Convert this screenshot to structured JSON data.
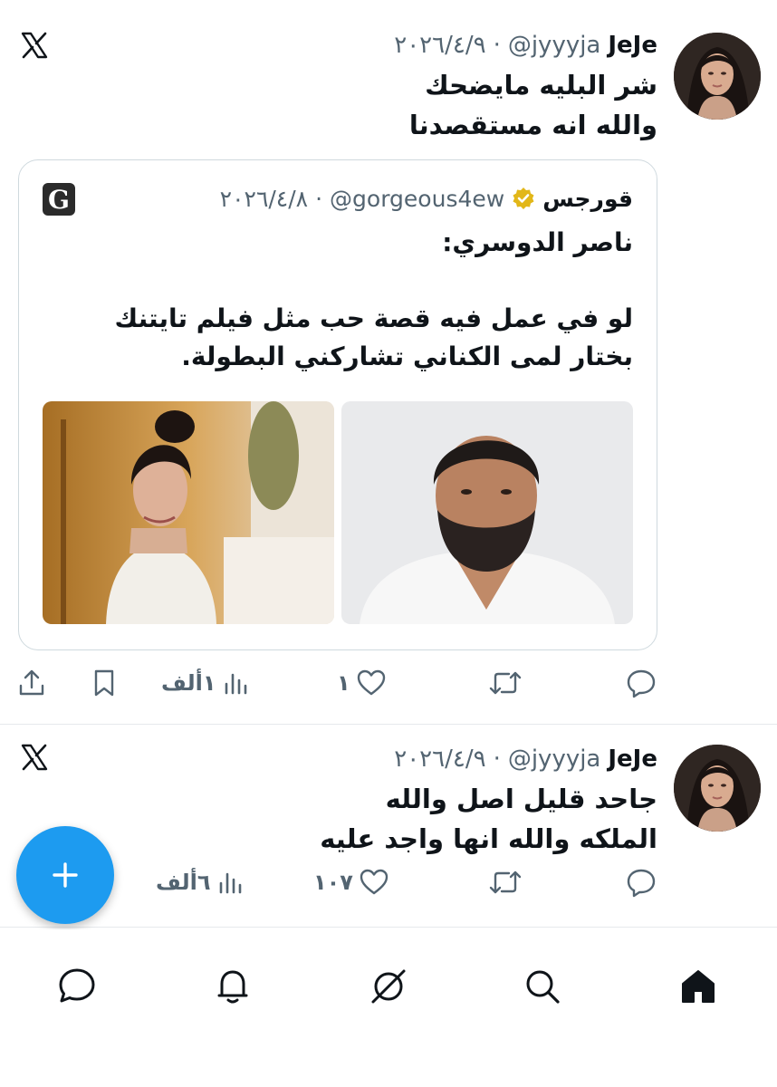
{
  "tweets": [
    {
      "display_name": "JeJe",
      "handle": "@jyyyja",
      "separator": "·",
      "date": "٢٠٢٦/٤/٩",
      "text_lines": [
        "شر البليه مايضحك",
        "والله انه مستقصدنا"
      ],
      "quote": {
        "display_name": "قورجس",
        "handle": "@gorgeous4ew",
        "separator": "·",
        "date": "٢٠٢٦/٤/٨",
        "badge": "G",
        "text_lines": [
          "ناصر الدوسري:",
          "",
          "لو في عمل فيه قصة حب مثل فيلم تايتنك",
          "بختار لمى الكناني تشاركني البطولة."
        ]
      },
      "actions": {
        "reply_count": "",
        "retweet_count": "",
        "like_count": "١",
        "views_count": "١ألف"
      }
    },
    {
      "display_name": "JeJe",
      "handle": "@jyyyja",
      "separator": "·",
      "date": "٢٠٢٦/٤/٩",
      "text_lines": [
        "جاحد قليل اصل والله",
        "الملكه والله انها واجد عليه"
      ],
      "actions": {
        "reply_count": "",
        "retweet_count": "",
        "like_count": "١٠٧",
        "views_count": "٦ألف"
      }
    }
  ],
  "fab": {
    "label": "+"
  },
  "colors": {
    "accent": "#1d9bf0",
    "muted": "#536471",
    "text": "#0f1419",
    "verified": "#e2b719"
  },
  "nav": [
    "home-icon",
    "search-icon",
    "grok-icon",
    "notifications-icon",
    "messages-icon"
  ]
}
